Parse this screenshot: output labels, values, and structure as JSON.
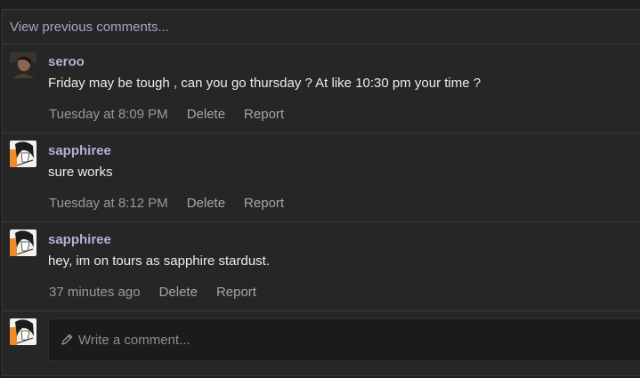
{
  "thread": {
    "view_previous": "View previous comments..."
  },
  "comments": [
    {
      "user": "seroo",
      "text": "Friday may be tough , can you go thursday ? At like 10:30 pm your time ?",
      "time": "Tuesday at 8:09 PM",
      "delete_label": "Delete",
      "report_label": "Report"
    },
    {
      "user": "sapphiree",
      "text": "sure works",
      "time": "Tuesday at 8:12 PM",
      "delete_label": "Delete",
      "report_label": "Report"
    },
    {
      "user": "sapphiree",
      "text": "hey, im on tours as sapphire stardust.",
      "time": "37 minutes ago",
      "delete_label": "Delete",
      "report_label": "Report"
    }
  ],
  "composer": {
    "placeholder": "Write a comment..."
  },
  "icons": {
    "compose": "pencil-icon"
  },
  "colors": {
    "username": "#b7aed6",
    "link": "#a9a3c6",
    "background": "#262626"
  }
}
